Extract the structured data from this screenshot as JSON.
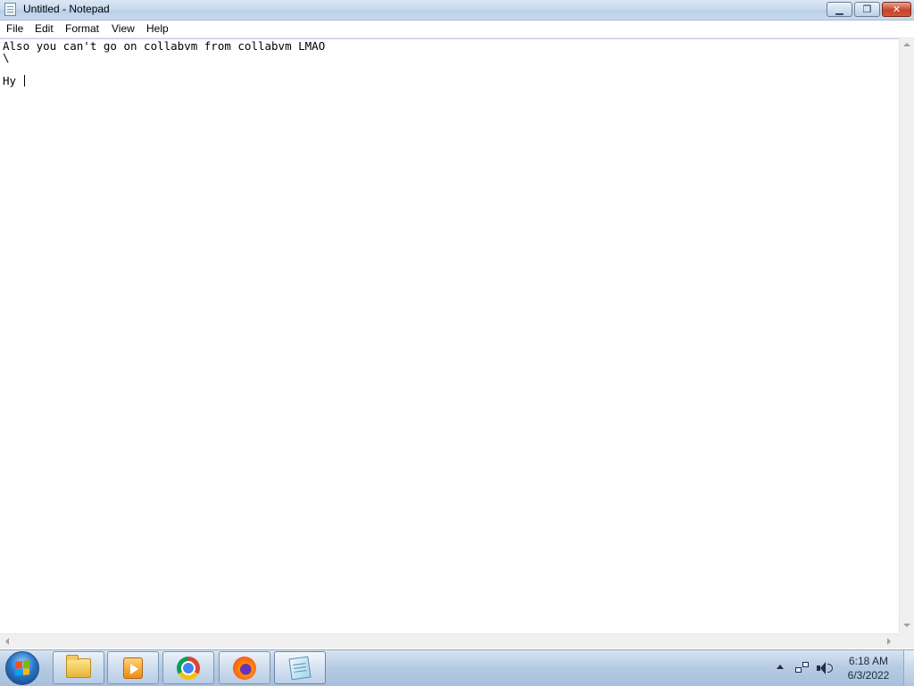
{
  "window": {
    "title": "Untitled - Notepad",
    "controls": {
      "minimize": "▁",
      "maximize": "❐",
      "close": "✕"
    }
  },
  "menu": {
    "items": [
      "File",
      "Edit",
      "Format",
      "View",
      "Help"
    ]
  },
  "document": {
    "lines": [
      "Also you can't go on collabvm from collabvm LMAO",
      "\\",
      "",
      "Hy "
    ]
  },
  "taskbar": {
    "pinned": [
      {
        "name": "windows-explorer",
        "icon": "folder-icon"
      },
      {
        "name": "windows-media-player",
        "icon": "media-player-icon"
      },
      {
        "name": "google-chrome",
        "icon": "chrome-icon"
      },
      {
        "name": "firefox",
        "icon": "firefox-icon"
      },
      {
        "name": "notepad",
        "icon": "notepad-icon",
        "active": true
      }
    ],
    "clock": {
      "time": "6:18 AM",
      "date": "6/3/2022"
    }
  },
  "colors": {
    "title_bar": "#c9dbef",
    "taskbar": "#b7cce3",
    "close_button": "#c7442a"
  }
}
